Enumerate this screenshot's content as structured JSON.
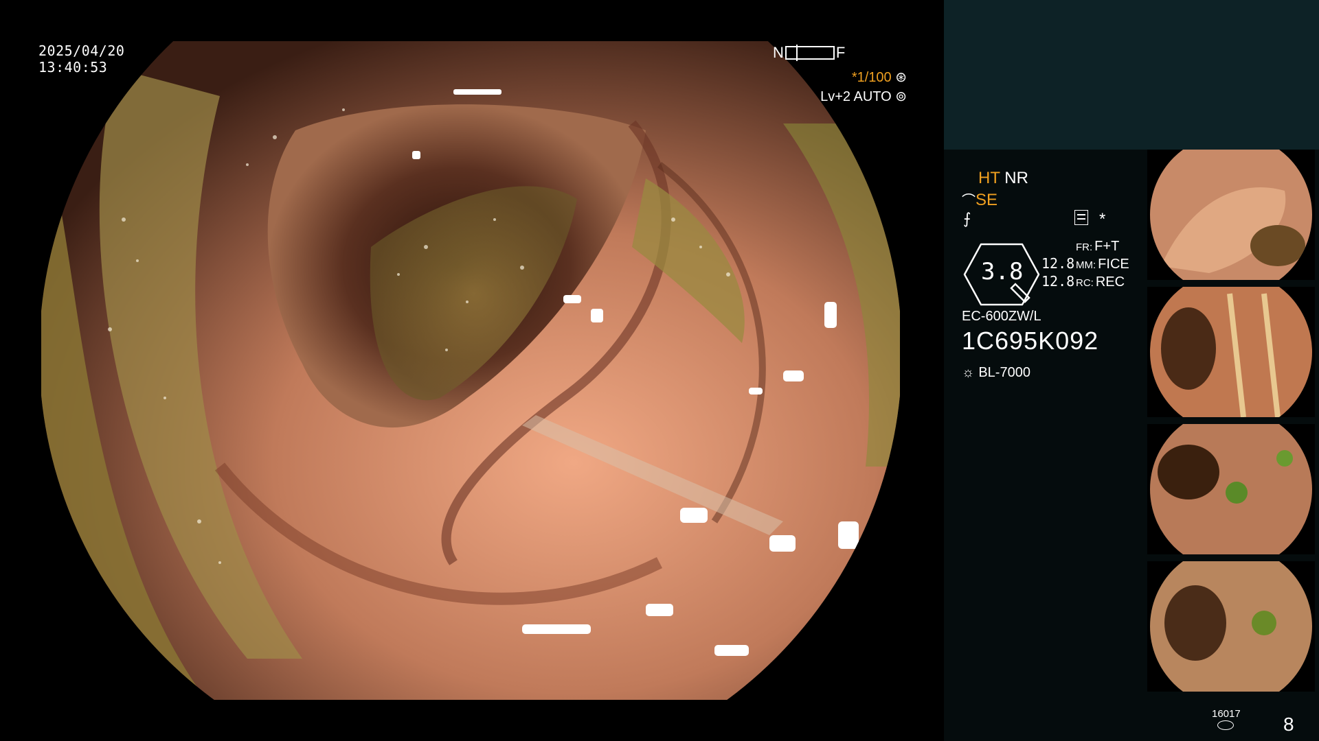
{
  "overlay": {
    "date": "2025/04/20",
    "time": "13:40:53",
    "near_label": "N",
    "far_label": "F",
    "shutter": "*1/100",
    "shutter_icon": "aperture-icon",
    "level": "Lv+2 AUTO",
    "level_icon": "iris-icon"
  },
  "panel": {
    "ht": "HT",
    "nr": "NR",
    "se": "SE",
    "se_icon": "enhance-icon",
    "tilde_icon": "structure-icon",
    "filter_icon": "filter-icon",
    "star": "*",
    "zoom_value": "3.8",
    "zoom_icon": "hexagon-zoom-icon",
    "val1": "12.8",
    "val2": "12.8",
    "fr_label": "FR:",
    "fr_value": "F+T",
    "mm_label": "MM:",
    "mm_value": "FICE",
    "rc_label": "RC:",
    "rc_value": "REC",
    "scope_model": "EC-600ZW/L",
    "scope_serial": "1C695K092",
    "light_icon": "light-source-icon",
    "light_source": "BL-7000",
    "storage_count": "16017",
    "storage_icon": "storage-drum-icon",
    "image_count": "8"
  },
  "colors": {
    "accent": "#f0a020",
    "panel_top": "#0d2226",
    "panel_bg": "#050c0d"
  }
}
